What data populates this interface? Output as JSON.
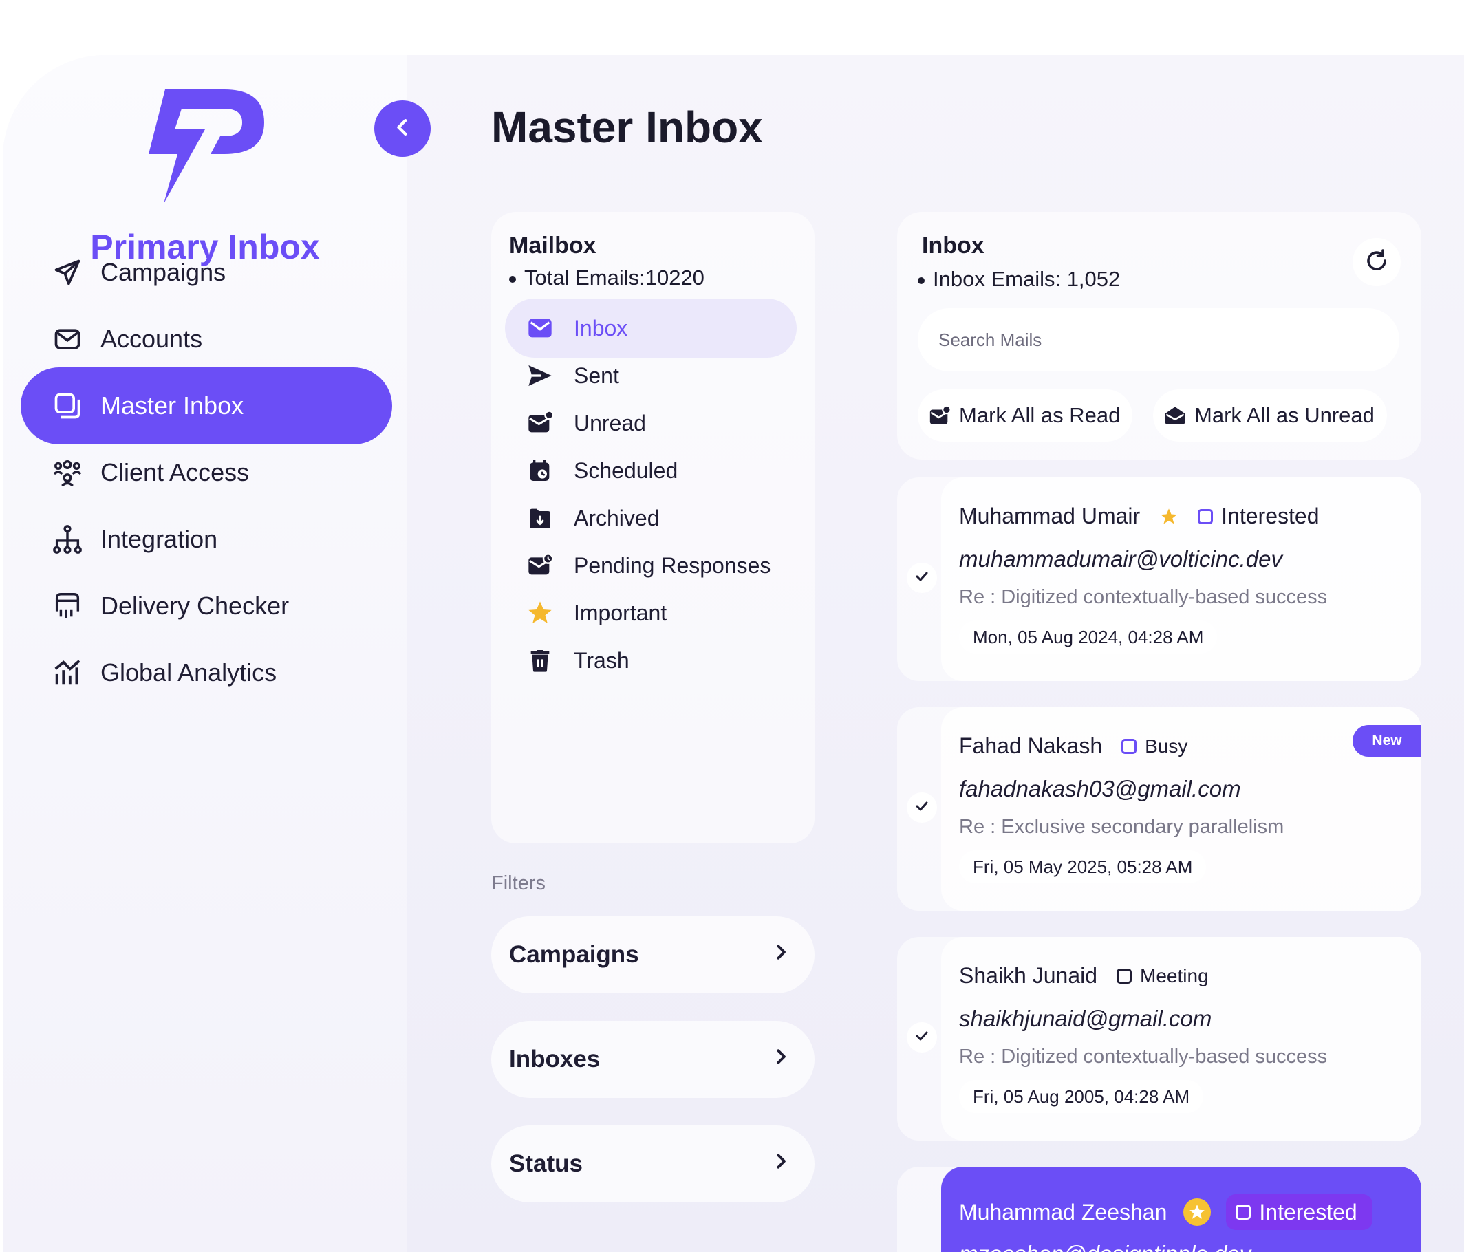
{
  "brand": {
    "name": "Primary Inbox",
    "accent": "#6b4ef6"
  },
  "sidebar": {
    "items": [
      {
        "label": "Campaigns",
        "icon": "send-icon",
        "active": false
      },
      {
        "label": "Accounts",
        "icon": "envelope-icon",
        "active": false
      },
      {
        "label": "Master Inbox",
        "icon": "stacked-squares-icon",
        "active": true
      },
      {
        "label": "Client Access",
        "icon": "users-icon",
        "active": false
      },
      {
        "label": "Integration",
        "icon": "hierarchy-icon",
        "active": false
      },
      {
        "label": "Delivery Checker",
        "icon": "delivery-icon",
        "active": false
      },
      {
        "label": "Global Analytics",
        "icon": "analytics-icon",
        "active": false
      }
    ]
  },
  "page": {
    "title": "Master Inbox"
  },
  "mailbox": {
    "title": "Mailbox",
    "total": "Total Emails:10220",
    "folders": [
      {
        "label": "Inbox",
        "icon": "envelope-icon",
        "active": true
      },
      {
        "label": "Sent",
        "icon": "paper-plane-icon",
        "active": false
      },
      {
        "label": "Unread",
        "icon": "unread-mail-icon",
        "active": false
      },
      {
        "label": "Scheduled",
        "icon": "calendar-clock-icon",
        "active": false
      },
      {
        "label": "Archived",
        "icon": "archive-icon",
        "active": false
      },
      {
        "label": "Pending Responses",
        "icon": "pending-mail-icon",
        "active": false
      },
      {
        "label": "Important",
        "icon": "star-icon",
        "active": false
      },
      {
        "label": "Trash",
        "icon": "trash-icon",
        "active": false
      }
    ]
  },
  "filters": {
    "label": "Filters",
    "items": [
      {
        "label": "Campaigns"
      },
      {
        "label": "Inboxes"
      },
      {
        "label": "Status"
      }
    ]
  },
  "inbox": {
    "title": "Inbox",
    "count": "Inbox Emails: 1,052",
    "search_placeholder": "Search Mails",
    "mark_read": "Mark All as Read",
    "mark_unread": "Mark All as Unread"
  },
  "emails": [
    {
      "name": "Muhammad Umair",
      "starred": true,
      "tag": "Interested",
      "email": "muhammadumair@volticinc.dev",
      "subject": "Re : Digitized contextually-based success",
      "date": "Mon, 05 Aug 2024, 04:28 AM",
      "is_new": false
    },
    {
      "name": "Fahad Nakash",
      "starred": false,
      "tag": "Busy",
      "email": "fahadnakash03@gmail.com",
      "subject": "Re : Exclusive secondary parallelism",
      "date": "Fri, 05 May 2025, 05:28 AM",
      "is_new": true,
      "badge": "New"
    },
    {
      "name": "Shaikh Junaid",
      "starred": false,
      "tag": "Meeting",
      "email": "shaikhjunaid@gmail.com",
      "subject": "Re : Digitized contextually-based success",
      "date": "Fri, 05 Aug 2005, 04:28 AM",
      "is_new": false
    },
    {
      "name": "Muhammad Zeeshan",
      "starred": true,
      "tag": "Interested",
      "email": "mzeeshan@designtipple.dev"
    }
  ]
}
